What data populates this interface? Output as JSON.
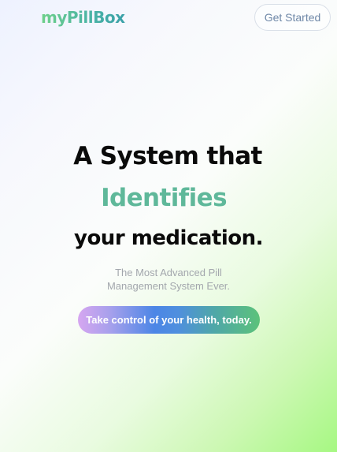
{
  "header": {
    "logo_text": "myPillBox",
    "get_started_label": "Get Started"
  },
  "hero": {
    "line1": "A System that",
    "line2": "Identifies",
    "line3": "your medication.",
    "subtitle_line1": "The Most Advanced Pill",
    "subtitle_line2": "Management System Ever.",
    "cta_label": "Take control of your health, today."
  },
  "colors": {
    "accent_green": "#5fb89a",
    "cta_gradient_start": "#d6a6f0",
    "cta_gradient_mid": "#4c86e6",
    "cta_gradient_end": "#5cc27a",
    "logo_green": "#6fd08a"
  }
}
